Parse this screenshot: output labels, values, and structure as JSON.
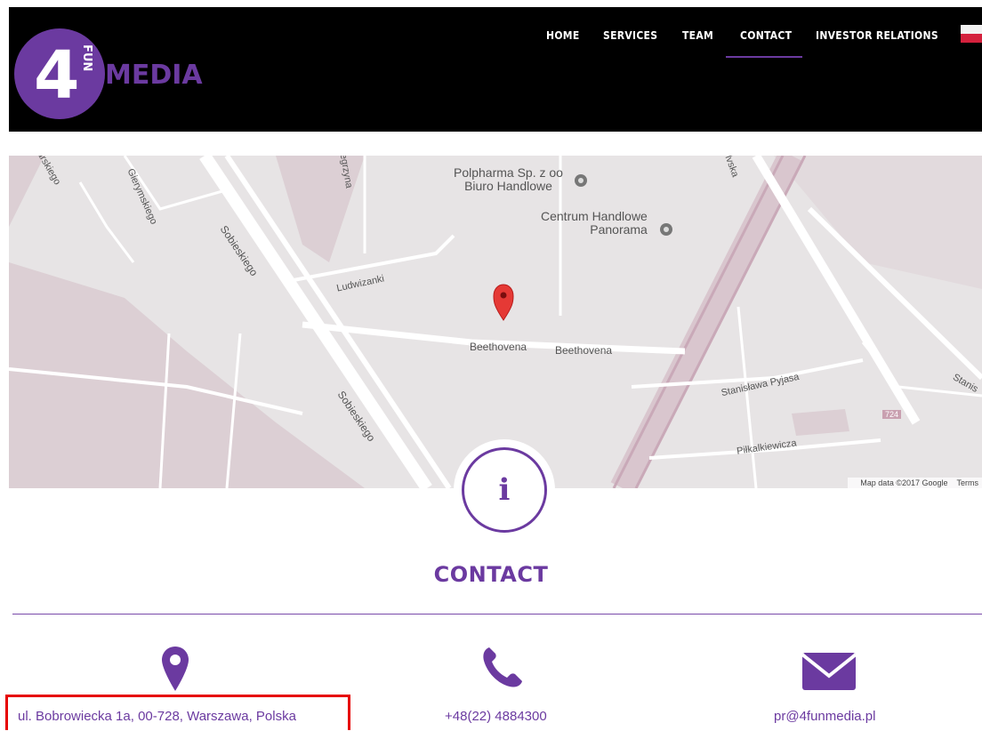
{
  "brand": {
    "logo_number": "4",
    "logo_fun": "FUN",
    "logo_media": "MEDIA"
  },
  "nav": {
    "items": [
      {
        "label": "HOME"
      },
      {
        "label": "SERVICES"
      },
      {
        "label": "TEAM"
      },
      {
        "label": "CONTACT",
        "active": true
      },
      {
        "label": "INVESTOR RELATIONS"
      }
    ],
    "language_flag": "polish-flag-icon"
  },
  "map": {
    "places": {
      "polpharma": [
        "Polpharma Sp. z oo",
        "Biuro Handlowe"
      ],
      "centrum": [
        "Centrum Handlowe",
        "Panorama"
      ]
    },
    "streets": {
      "ludwinki": "Ludwizanki",
      "beethovena1": "Beethovena",
      "beethovena2": "Beethovena",
      "sobieskiego1": "Sobieskiego",
      "sobieskiego2": "Sobieskiego",
      "gierymskiego": "Gierymskiego",
      "pyjasa": "Stanisława Pyjasa",
      "pilkalkiewicza": "Piłkalkiewicza",
      "arskiego": "arskiego",
      "legrzyna": "legrzyna",
      "ivska": "lvska",
      "stanis": "Stanis",
      "road_724": "724"
    },
    "footer_data": "Map data ©2017 Google",
    "footer_terms": "Terms"
  },
  "contact": {
    "title": "CONTACT",
    "address": "ul. Bobrowiecka 1a, 00-728, Warszawa, Polska",
    "phone": "+48(22) 4884300",
    "email": "pr@4funmedia.pl"
  },
  "colors": {
    "accent": "#6b3aa0",
    "highlight": "#e60000",
    "header_bg": "#000000"
  }
}
